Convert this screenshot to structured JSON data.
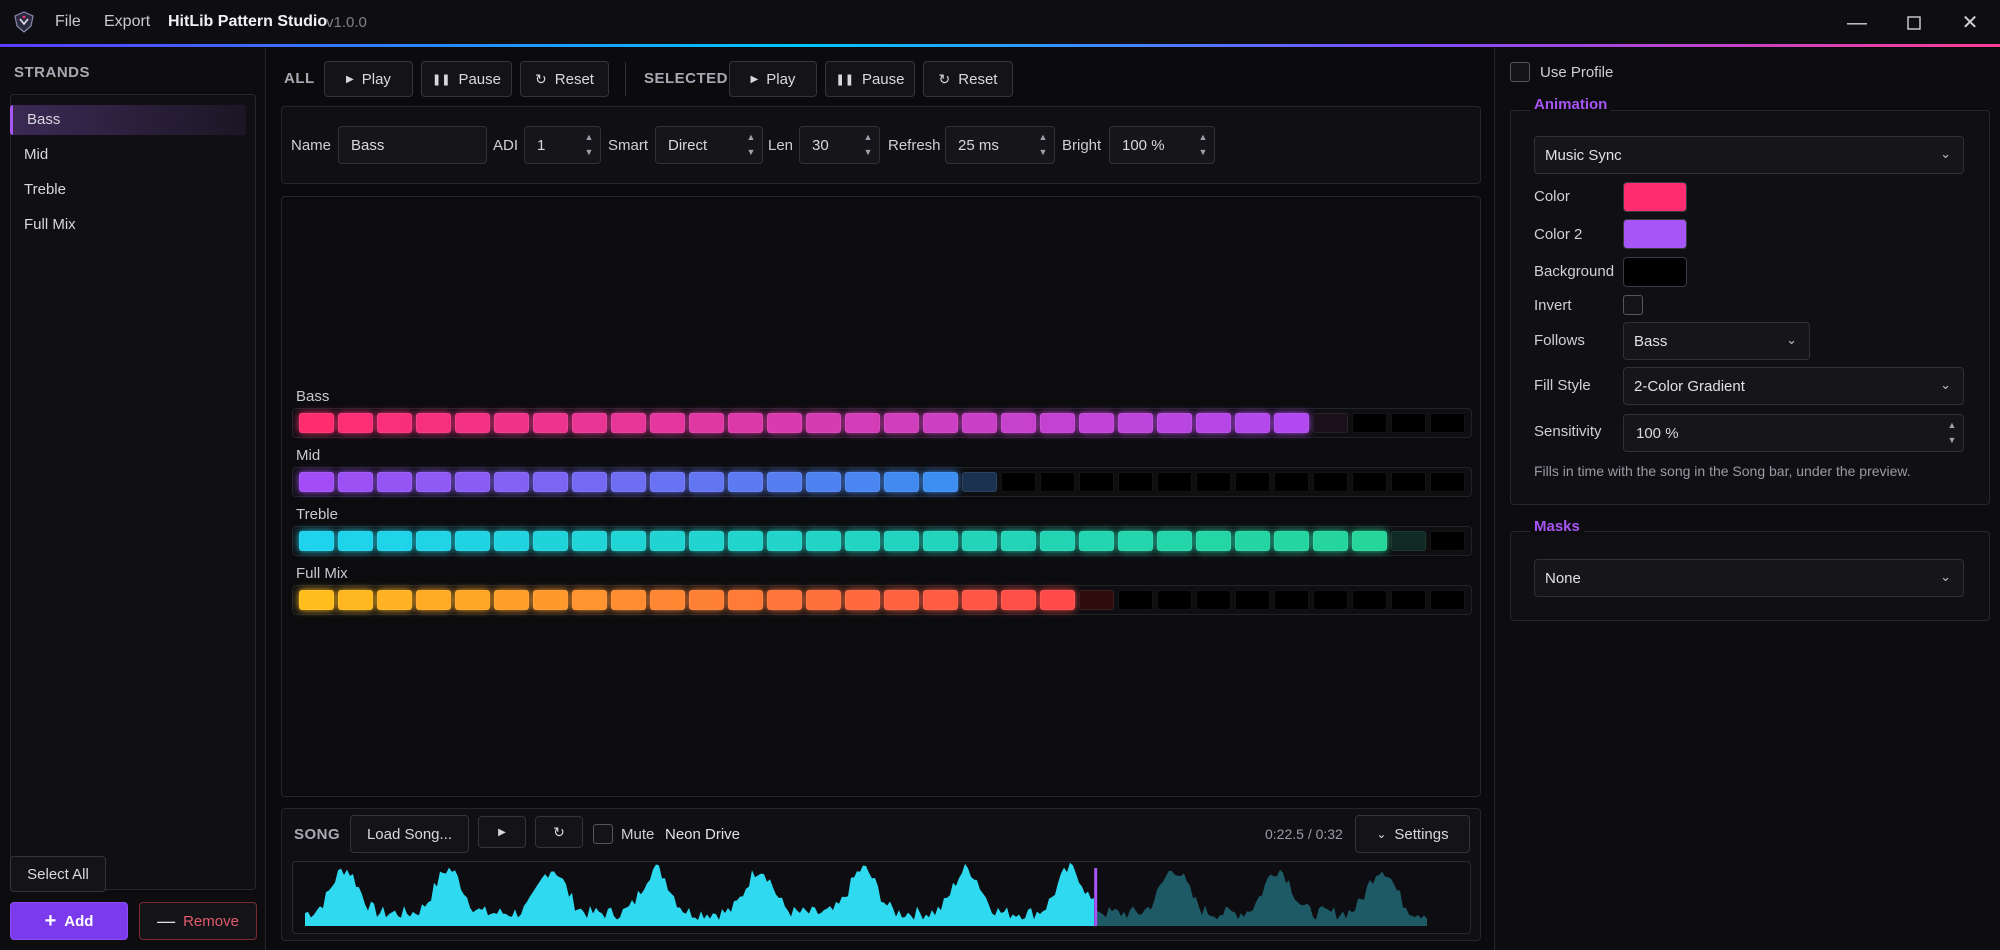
{
  "app": {
    "title": "HitLib Pattern Studio",
    "version": "v1.0.0",
    "menu": [
      "File",
      "Export"
    ]
  },
  "strands": {
    "header": "STRANDS",
    "items": [
      "Bass",
      "Mid",
      "Treble",
      "Full Mix"
    ],
    "selected": "Bass",
    "select_all_label": "Select All",
    "add_label": "Add",
    "remove_label": "Remove"
  },
  "playback": {
    "all_label": "ALL",
    "selected_label": "SELECTED",
    "play_label": "Play",
    "pause_label": "Pause",
    "reset_label": "Reset"
  },
  "props": {
    "name_label": "Name",
    "name_value": "Bass",
    "adi_label": "ADI",
    "adi_value": "1",
    "smart_label": "Smart",
    "smart_value": "Direct",
    "len_label": "Len",
    "len_value": "30",
    "refresh_label": "Refresh",
    "refresh_value": "25 ms",
    "bright_label": "Bright",
    "bright_value": "100 %"
  },
  "preview": {
    "led_count": 30,
    "strips": [
      {
        "name": "Bass",
        "lit": 26,
        "dim_index": 26,
        "from": "#ff2d6f",
        "to": "#b049f0",
        "dim": "#1a0f1a"
      },
      {
        "name": "Mid",
        "lit": 17,
        "dim_index": 17,
        "from": "#a24df5",
        "to": "#3c8ef0",
        "dim": "#1b3150"
      },
      {
        "name": "Treble",
        "lit": 28,
        "dim_index": 28,
        "from": "#1fd3ee",
        "to": "#25d59a",
        "dim": "#0f2a22"
      },
      {
        "name": "Full Mix",
        "lit": 20,
        "dim_index": 20,
        "from": "#ffbe1e",
        "to": "#ff4a4a",
        "dim": "#2e0c0c"
      }
    ]
  },
  "song": {
    "label": "SONG",
    "load_label": "Load Song...",
    "mute_label": "Mute",
    "title": "Neon Drive",
    "time": "0:22.5 / 0:32",
    "settings_label": "Settings",
    "progress": 0.703
  },
  "animation": {
    "use_profile_label": "Use Profile",
    "section_title": "Animation",
    "type": "Music Sync",
    "color_label": "Color",
    "color": "#ff2d6f",
    "color2_label": "Color 2",
    "color2": "#a855f7",
    "background_label": "Background",
    "background": "#000000",
    "invert_label": "Invert",
    "follows_label": "Follows",
    "follows": "Bass",
    "fill_style_label": "Fill Style",
    "fill_style": "2-Color Gradient",
    "sensitivity_label": "Sensitivity",
    "sensitivity": "100 %",
    "hint": "Fills in time with the song in the Song bar, under the preview."
  },
  "masks": {
    "section_title": "Masks",
    "value": "None"
  },
  "colors": {
    "accent": "#a855f7",
    "wave": "#2fd9f0",
    "wave_dim": "#1d5a66"
  }
}
